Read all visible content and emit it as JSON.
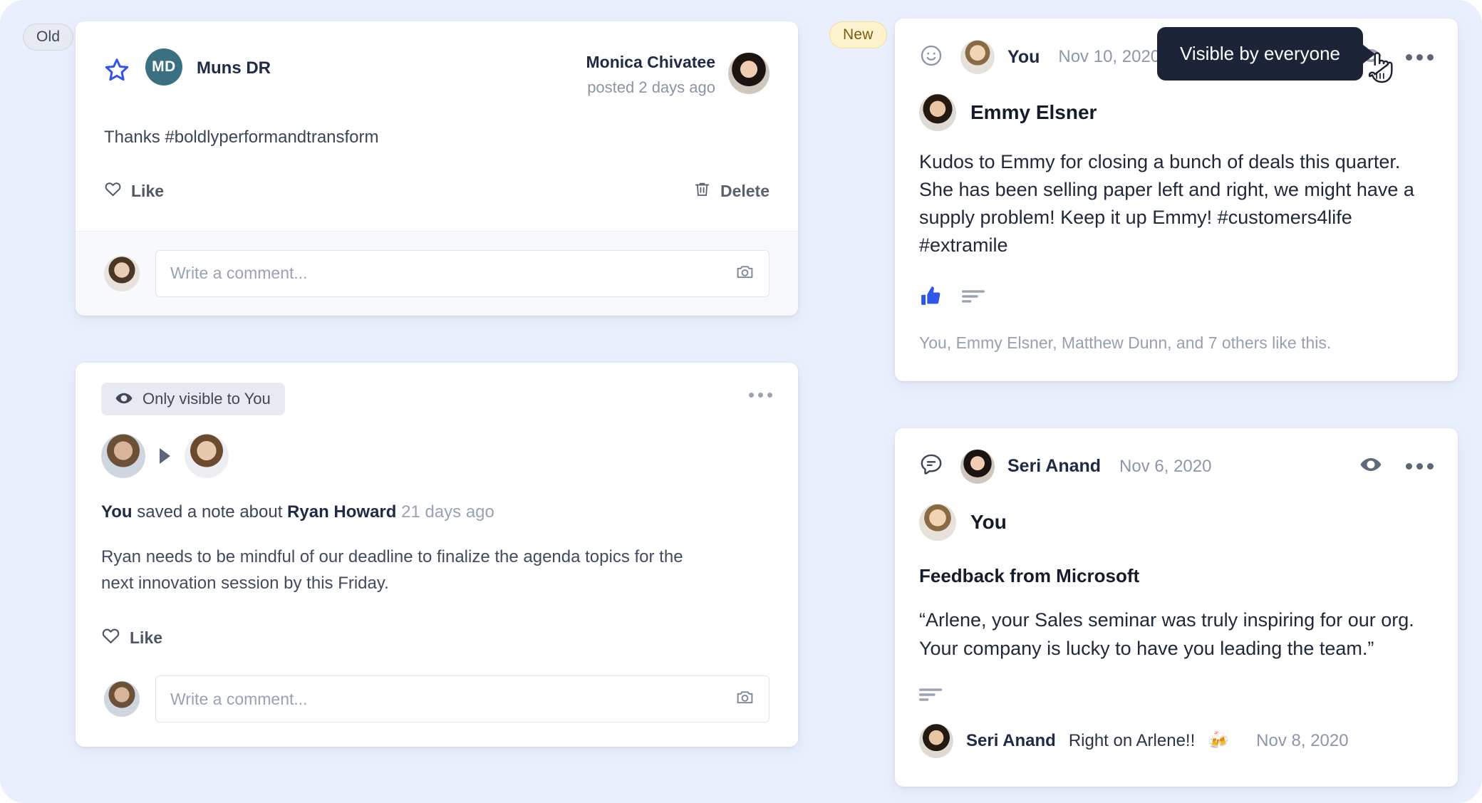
{
  "gutter": {
    "old_badge": "Old",
    "new_badge": "New"
  },
  "tooltip": {
    "text": "Visible by everyone"
  },
  "left_column": {
    "post_card": {
      "star_icon": "star-icon",
      "avatar_initials": "MD",
      "author": "Muns DR",
      "meta_name": "Monica Chivatee",
      "meta_time": "posted 2 days ago",
      "body": "Thanks #boldlyperformandtransform",
      "like_label": "Like",
      "delete_label": "Delete",
      "composer_placeholder": "Write a comment...",
      "camera_icon": "camera-icon"
    },
    "note_card": {
      "visibility_label": "Only visible to You",
      "eye_icon": "eye-icon",
      "more_icon": "ellipsis-icon",
      "line_prefix": "You",
      "line_middle": " saved a note about ",
      "line_subject": "Ryan Howard",
      "line_time": "21 days ago",
      "body": "Ryan needs to be mindful of our deadline to finalize the agenda topics for the next innovation session by this Friday.",
      "like_label": "Like",
      "composer_placeholder": "Write a comment...",
      "camera_icon": "camera-icon"
    }
  },
  "right_column": {
    "kudos_card": {
      "type_icon": "smiley-icon",
      "head_name": "You",
      "head_date": "Nov 10, 2020",
      "eye_icon": "eye-icon",
      "more_icon": "ellipsis-icon",
      "author": "Emmy Elsner",
      "text": "Kudos to Emmy for closing a bunch of deals this quarter. She has been selling paper left and right, we might have a supply problem! Keep it up Emmy! #customers4life #extramile",
      "thumb_icon": "thumbs-up-icon",
      "comment_icon": "comment-lines-icon",
      "likes_summary": "You, Emmy Elsner, Matthew Dunn, and 7 others like this."
    },
    "feedback_card": {
      "type_icon": "speech-bubble-icon",
      "head_name": "Seri Anand",
      "head_date": "Nov 6, 2020",
      "eye_icon": "eye-icon",
      "more_icon": "ellipsis-icon",
      "author": "You",
      "subject": "Feedback from Microsoft",
      "quote": "“Arlene, your Sales seminar was truly inspiring for our org. Your company is lucky to have you leading the team.”",
      "comment_icon": "comment-lines-icon",
      "comment_author": "Seri Anand",
      "comment_text": "Right on Arlene!!",
      "comment_emoji": "🍻",
      "comment_date": "Nov 8, 2020"
    }
  },
  "colors": {
    "page_background": "#e9effc",
    "card_background": "#ffffff",
    "accent_blue": "#2f56e8",
    "tooltip_background": "#1d2438",
    "new_badge_background": "#fdf3cf",
    "avatar_teal": "#3b7083"
  }
}
